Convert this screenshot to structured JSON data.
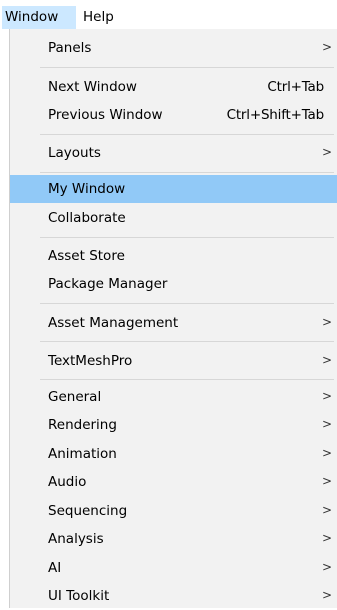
{
  "menubar": {
    "window_label": "Window",
    "help_label": "Help"
  },
  "menu": {
    "panels": "Panels",
    "next_window": "Next Window",
    "next_window_shortcut": "Ctrl+Tab",
    "previous_window": "Previous Window",
    "previous_window_shortcut": "Ctrl+Shift+Tab",
    "layouts": "Layouts",
    "my_window": "My Window",
    "collaborate": "Collaborate",
    "asset_store": "Asset Store",
    "package_manager": "Package Manager",
    "asset_management": "Asset Management",
    "textmeshpro": "TextMeshPro",
    "general": "General",
    "rendering": "Rendering",
    "animation": "Animation",
    "audio": "Audio",
    "sequencing": "Sequencing",
    "analysis": "Analysis",
    "ai": "AI",
    "ui_toolkit": "UI Toolkit"
  },
  "icons": {
    "submenu": ">"
  },
  "colors": {
    "menu_background": "#f2f2f2",
    "highlight": "#91c9f7",
    "menubar_active": "#cce8ff",
    "separator": "#d7d7d7"
  }
}
